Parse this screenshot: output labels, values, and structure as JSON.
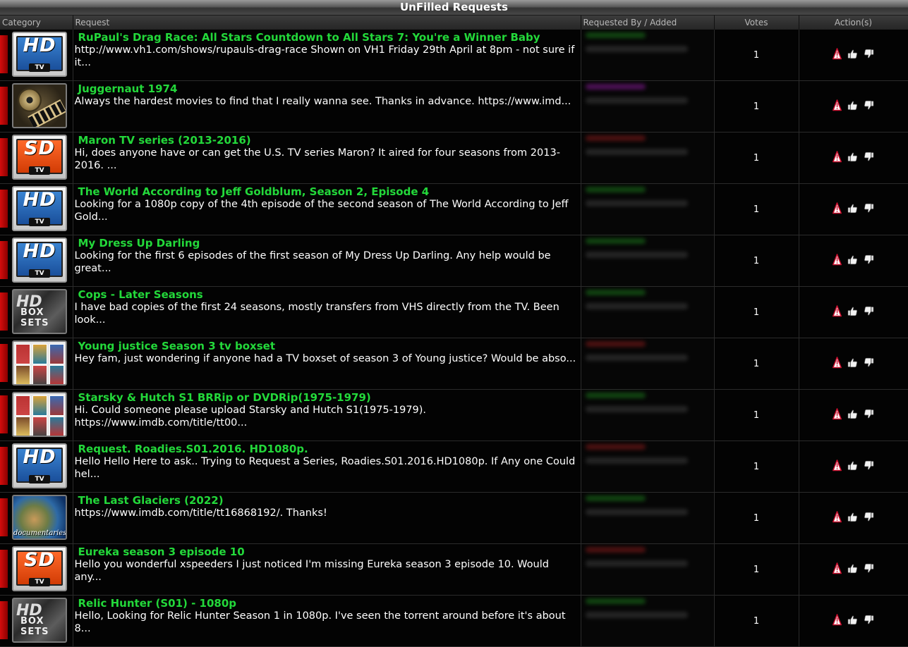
{
  "page": {
    "title": "UnFilled Requests"
  },
  "columns": {
    "category": "Category",
    "request": "Request",
    "requested_by": "Requested By / Added",
    "votes": "Votes",
    "actions": "Action(s)"
  },
  "icons": {
    "report": "report-warning-icon",
    "vote_up": "thumbs-up-icon",
    "vote_down": "thumbs-down-icon"
  },
  "requests": [
    {
      "category_icon": "hd-tv",
      "title": "RuPaul's Drag Race: All Stars Countdown to All Stars 7: You're a Winner Baby",
      "desc": "http://www.vh1.com/shows/rupauls-drag-race Shown on VH1 Friday 29th April at 8pm - not sure if it...",
      "user_color": "#1a7a1a",
      "votes": "1"
    },
    {
      "category_icon": "movie-reel",
      "title": "Juggernaut 1974",
      "desc": " Always the hardest movies to find that I really wanna see. Thanks in advance. https://www.imd...",
      "user_color": "#8a1a9a",
      "votes": "1"
    },
    {
      "category_icon": "sd-tv",
      "title": "Maron TV series (2013-2016)",
      "desc": " Hi, does anyone have or can get the U.S. TV series Maron? It aired for four seasons from 2013-2016. ...",
      "user_color": "#8a1a1a",
      "votes": "1"
    },
    {
      "category_icon": "hd-tv",
      "title": "The World According to Jeff Goldblum, Season 2, Episode 4",
      "desc": " Looking for a 1080p copy of the 4th episode of the second season of The World According to Jeff Gold...",
      "user_color": "#1a7a1a",
      "votes": "1"
    },
    {
      "category_icon": "hd-tv",
      "title": "My Dress Up Darling",
      "desc": " Looking for the first 6 episodes of the first season of My Dress Up Darling. Any help would be great...",
      "user_color": "#1a7a1a",
      "votes": "1"
    },
    {
      "category_icon": "hd-box-sets",
      "title": "Cops - Later Seasons",
      "desc": " I have bad copies of the first 24 seasons, mostly transfers from VHS directly from the TV. Been look...",
      "user_color": "#1a7a1a",
      "votes": "1"
    },
    {
      "category_icon": "tv-box-sets",
      "title": "Young justice Season 3 tv boxset",
      "desc": " Hey fam, just wondering if anyone had a TV boxset of season 3 of Young justice? Would be abso...",
      "user_color": "#8a1a1a",
      "votes": "1"
    },
    {
      "category_icon": "tv-box-sets",
      "title": "Starsky & Hutch S1 BRRip or DVDRip(1975-1979)",
      "desc": " Hi. Could someone please upload Starsky and Hutch S1(1975-1979). https://www.imdb.com/title/tt00...",
      "user_color": "#1a7a1a",
      "votes": "1"
    },
    {
      "category_icon": "hd-tv",
      "title": "Request. Roadies.S01.2016. HD1080p.",
      "desc": " Hello Hello Here to ask.. Trying to Request a Series, Roadies.S01.2016.HD1080p. If Any one Could hel...",
      "user_color": "#8a1a1a",
      "votes": "1"
    },
    {
      "category_icon": "documentaries",
      "title": "The Last Glaciers (2022)",
      "desc": " https://www.imdb.com/title/tt16868192/. Thanks!",
      "user_color": "#1a7a1a",
      "votes": "1"
    },
    {
      "category_icon": "sd-tv",
      "title": "Eureka season 3 episode 10",
      "desc": " Hello you wonderful xspeeders I just noticed I'm missing Eureka season 3 episode 10. Would any...",
      "user_color": "#8a1a1a",
      "votes": "1"
    },
    {
      "category_icon": "hd-box-sets",
      "title": "Relic Hunter (S01) - 1080p",
      "desc": " Hello, Looking for Relic Hunter Season 1 in 1080p. I've seen the torrent around before it's about 8...",
      "user_color": "#1a7a1a",
      "votes": "1"
    }
  ],
  "icon_text": {
    "hd": "HD",
    "sd": "SD",
    "tv": "TV",
    "box_sets": "BOX SETS",
    "documentaries": "documentaries"
  }
}
